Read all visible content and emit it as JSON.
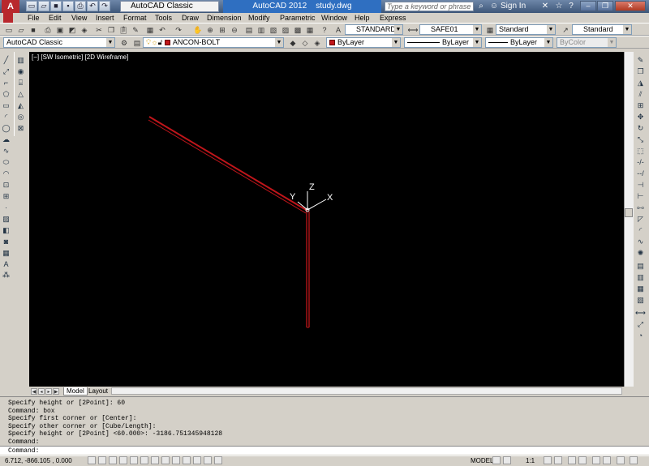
{
  "titlebar": {
    "logo": "A",
    "workspace": "AutoCAD Classic",
    "app_title": "AutoCAD 2012",
    "file": "study.dwg",
    "search_placeholder": "Type a keyword or phrase",
    "signin": "Sign In"
  },
  "menu": [
    "File",
    "Edit",
    "View",
    "Insert",
    "Format",
    "Tools",
    "Draw",
    "Dimension",
    "Modify",
    "Parametric",
    "Window",
    "Help",
    "Express"
  ],
  "toolbar2": {
    "text_style": "STANDARD",
    "dim_style": "SAFE01",
    "table_style": "Standard",
    "multileader_style": "Standard"
  },
  "toolbar3": {
    "workspace": "AutoCAD Classic",
    "layer": "ANCON-BOLT",
    "color": "ByLayer",
    "linetype": "ByLayer",
    "lineweight": "ByLayer",
    "plotstyle": "ByColor"
  },
  "viewport": {
    "label": "[−] [SW Isometric] [2D Wireframe]",
    "ucs": {
      "x": "X",
      "y": "Y",
      "z": "Z"
    }
  },
  "tabs": {
    "model": "Model",
    "layout": "Layout"
  },
  "command": {
    "history": [
      "Specify height or [2Point]: 60",
      "Command: box",
      "Specify first corner or [Center]:",
      "Specify other corner or [Cube/Length]:",
      "Specify height or [2Point] <60.000>: -3186.751345948128",
      "Command:"
    ],
    "prompt": "Command:"
  },
  "status": {
    "coords": "6.712, -866.105 , 0.000",
    "model": "MODEL",
    "scale": "1:1"
  },
  "colors": {
    "accent_red": "#c0151a",
    "viewport_bg": "#000000",
    "title_blue": "#2f6fc1"
  }
}
